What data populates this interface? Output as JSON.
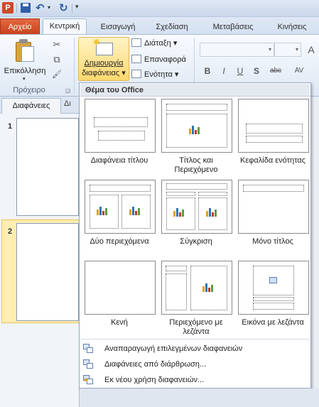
{
  "colors": {
    "file_tab": "#d24726",
    "accent_chart": [
      "#e4a11b",
      "#2e75b6",
      "#c0392b",
      "#5a9e3a"
    ]
  },
  "quick_access": {
    "app_icon": "P",
    "undo_icon": "↶",
    "redo_icon": "↻",
    "dropdown_icon": "▾"
  },
  "tabs": {
    "file": "Αρχείο",
    "items": [
      "Κεντρική",
      "Εισαγωγή",
      "Σχεδίαση",
      "Μεταβάσεις",
      "Κινήσεις"
    ]
  },
  "ribbon": {
    "clipboard": {
      "paste_label": "Επικόλληση",
      "group_label": "Πρόχειρο",
      "cut_icon": "✂",
      "copy_icon": "⧉",
      "format_painter_icon": "🖌"
    },
    "slides": {
      "new_slide_line1": "Δημιουργία",
      "new_slide_line2": "διαφάνειας",
      "layout_label": "Διάταξη",
      "reset_label": "Επαναφορά",
      "section_label": "Ενότητα"
    },
    "font": {
      "grow_icon": "A",
      "bold": "B",
      "italic": "I",
      "underline": "U",
      "shadow": "S",
      "strike": "abc",
      "spacing": "AV"
    }
  },
  "panel": {
    "tab_slides": "Διαφάνειες",
    "tab_outline": "Δι",
    "slide_numbers": [
      "1",
      "2"
    ]
  },
  "gallery": {
    "header": "Θέμα του Office",
    "layouts": [
      "Διαφάνεια τίτλου",
      "Τίτλος και Περιεχόμενο",
      "Κεφαλίδα ενότητας",
      "Δύο περιεχόμενα",
      "Σύγκριση",
      "Μόνο τίτλος",
      "Κενή",
      "Περιεχόμενο με λεζάντα",
      "Εικόνα με λεζάντα"
    ],
    "menu": [
      "Αναπαραγωγή επιλεγμένων διαφανειών",
      "Διαφάνειες από διάρθρωση...",
      "Εκ νέου χρήση διαφανειών..."
    ]
  }
}
